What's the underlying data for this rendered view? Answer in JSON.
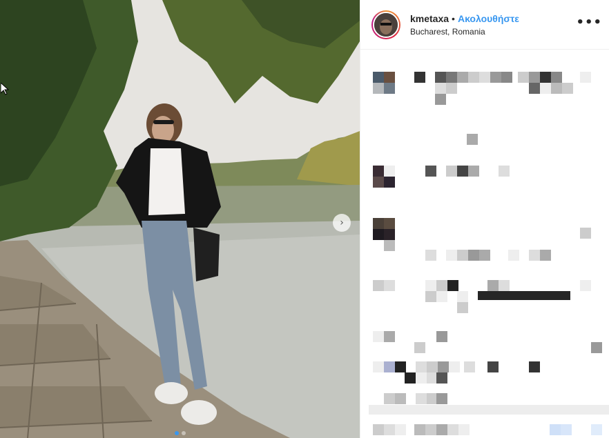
{
  "post": {
    "username": "kmetaxa",
    "separator": "•",
    "follow_label": "Ακολουθήστε",
    "location": "Bucharest, Romania",
    "more_label": "•••"
  },
  "photo": {
    "next_icon": "chevron-right-icon",
    "slides_count": 2,
    "active_slide": 1
  },
  "colors": {
    "accent": "#3897f0",
    "text": "#262626",
    "border": "#efefef"
  }
}
